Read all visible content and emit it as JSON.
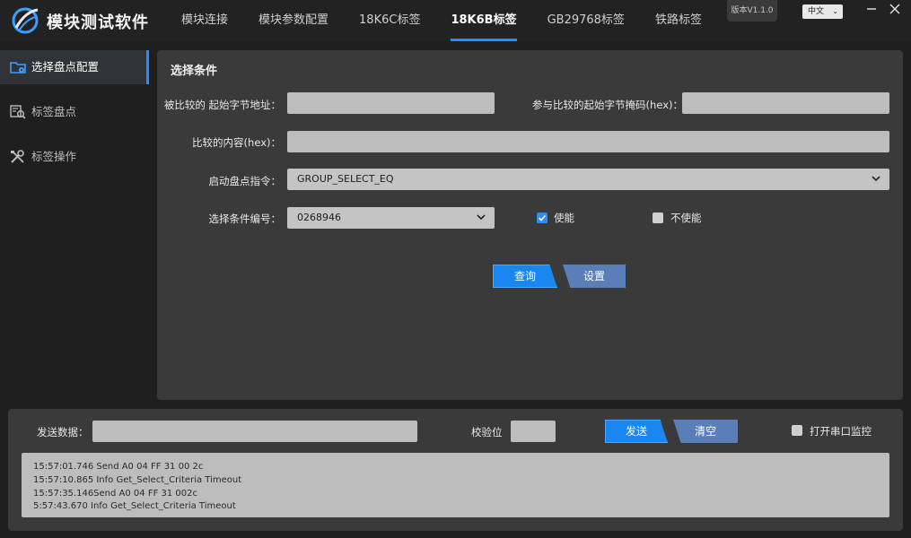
{
  "app": {
    "title": "模块测试软件",
    "version": "版本V1.1.0",
    "language": "中文"
  },
  "tabs": [
    {
      "label": "模块连接",
      "active": false
    },
    {
      "label": "模块参数配置",
      "active": false
    },
    {
      "label": "18K6C标签",
      "active": false
    },
    {
      "label": "18K6B标签",
      "active": true
    },
    {
      "label": "GB29768标签",
      "active": false
    },
    {
      "label": "铁路标签",
      "active": false
    }
  ],
  "sidebar": {
    "items": [
      {
        "label": "选择盘点配置",
        "icon": "folder-gear-icon",
        "active": true
      },
      {
        "label": "标签盘点",
        "icon": "tag-scan-icon",
        "active": false
      },
      {
        "label": "标签操作",
        "icon": "tools-icon",
        "active": false
      }
    ]
  },
  "panel": {
    "title": "选择条件",
    "compare_start_addr_label": "被比较的 起始字节地址：",
    "compare_start_addr_value": "",
    "mask_start_label": "参与比较的起始字节掩码(hex)：",
    "mask_start_value": "",
    "compare_content_label": "比较的内容(hex)：",
    "compare_content_value": "",
    "start_cmd_label": "启动盘点指令：",
    "start_cmd_value": "GROUP_SELECT_EQ",
    "condition_no_label": "选择条件编号：",
    "condition_no_value": "0268946",
    "enable_label": "使能",
    "enable_checked": true,
    "disable_label": "不使能",
    "disable_checked": false,
    "query_button": "查询",
    "set_button": "设置"
  },
  "bottom": {
    "send_data_label": "发送数据：",
    "send_data_value": "",
    "checksum_label": "校验位",
    "checksum_value": "",
    "send_button": "发送",
    "clear_button": "清空",
    "serial_monitor_label": "打开串口监控",
    "serial_monitor_checked": false,
    "log_lines": [
      "15:57:01.746 Send A0 04 FF 31 00 2c",
      "15:57:10.865 Info Get_Select_Criteria Timeout",
      "15:57:35.146Send A0 04 FF 31 002c",
      "5:57:43.670 Info Get_Select_Criteria Timeout"
    ]
  },
  "colors": {
    "accent": "#1f8fff",
    "background": "#1f1f1f",
    "panel": "#3a3a3a",
    "field": "#bdbdbd",
    "secondary_button": "#5a7fb8"
  }
}
